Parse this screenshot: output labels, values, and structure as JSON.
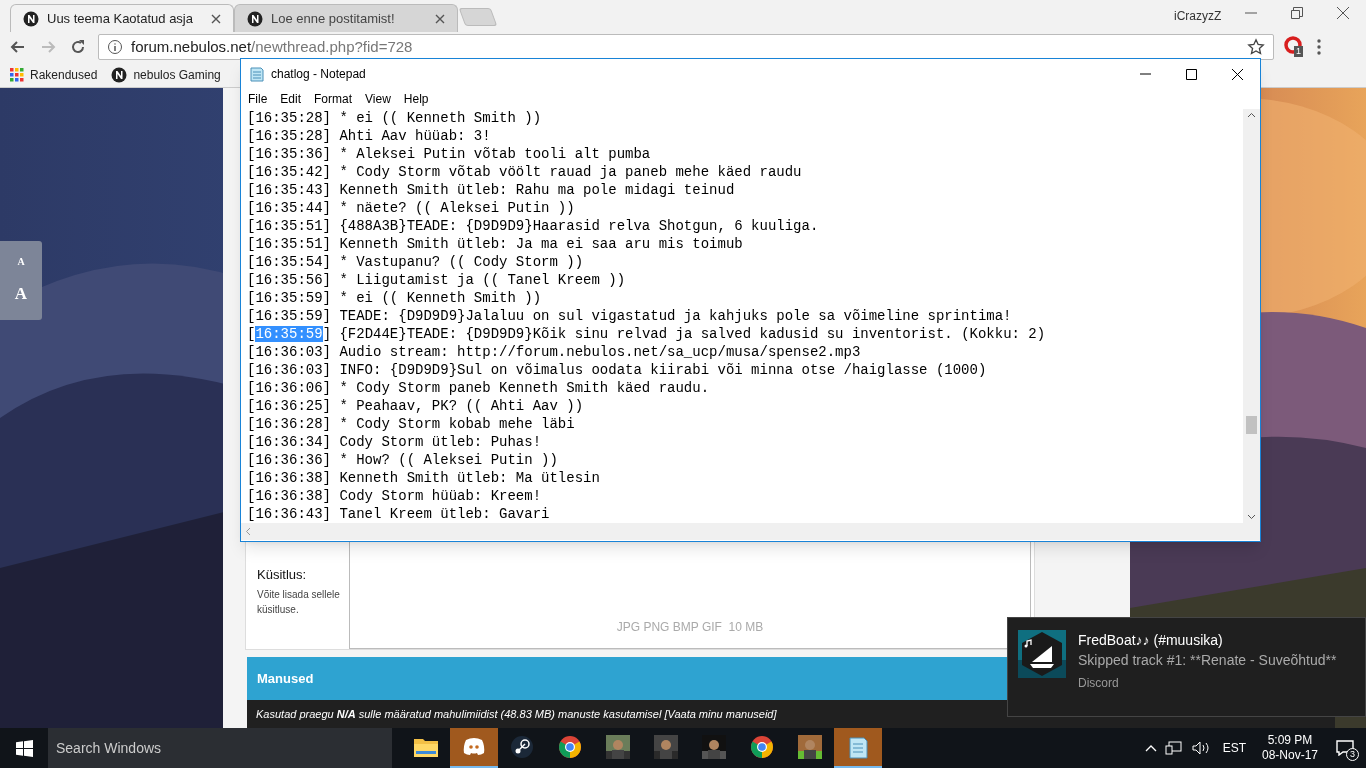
{
  "browser": {
    "tabs": [
      {
        "title": "Uus teema Kaotatud asja",
        "selected": true
      },
      {
        "title": "Loe enne postitamist!",
        "selected": false
      }
    ],
    "profile": "iCrazyzZ",
    "address": {
      "host": "forum.nebulos.net",
      "path": "/newthread.php?fid=728"
    },
    "extension_badge": "1",
    "bookmarks": [
      {
        "label": "Rakendused",
        "kind": "apps"
      },
      {
        "label": "nebulos Gaming",
        "kind": "site"
      }
    ]
  },
  "page": {
    "font_sizes": [
      "A",
      "A"
    ],
    "poll": {
      "title": "Küsitlus:",
      "text": "Võite lisada sellele küsitluse."
    },
    "upload_hint": "JPG PNG BMP GIF  10 MB",
    "attachments": {
      "title": "Manused",
      "text": "Kasutad praegu **N/A** sulle määratud mahulimiidist (48.83 MB) manuste kasutamisel [Vaata minu manuseid]"
    }
  },
  "notepad": {
    "title": "chatlog - Notepad",
    "menu": [
      "File",
      "Edit",
      "Format",
      "View",
      "Help"
    ],
    "lines": [
      {
        "text": "[16:35:28] * ei (( Kenneth Smith ))"
      },
      {
        "text": "[16:35:28] Ahti Aav hüüab: 3!"
      },
      {
        "text": "[16:35:36] * Aleksei Putin võtab tooli alt pumba"
      },
      {
        "text": "[16:35:42] * Cody Storm võtab vöölt rauad ja paneb mehe käed raudu"
      },
      {
        "text": "[16:35:43] Kenneth Smith ütleb: Rahu ma pole midagi teinud"
      },
      {
        "text": "[16:35:44] * näete? (( Aleksei Putin ))"
      },
      {
        "text": "[16:35:51] {488A3B}TEADE: {D9D9D9}Haarasid relva Shotgun, 6 kuuliga."
      },
      {
        "text": "[16:35:51] Kenneth Smith ütleb: Ja ma ei saa aru mis toimub"
      },
      {
        "text": "[16:35:54] * Vastupanu? (( Cody Storm ))"
      },
      {
        "text": "[16:35:56] * Liigutamist ja (( Tanel Kreem ))"
      },
      {
        "text": "[16:35:59] * ei (( Kenneth Smith ))"
      },
      {
        "text": "[16:35:59] TEADE: {D9D9D9}Jalaluu on sul vigastatud ja kahjuks pole sa võimeline sprintima!"
      },
      {
        "text": "[",
        "selection": "16:35:59",
        "rest": "] {F2D44E}TEADE: {D9D9D9}Kõik sinu relvad ja salved kadusid su inventorist. (Kokku: 2)"
      },
      {
        "text": "[16:36:03] Audio stream: http://forum.nebulos.net/sa_ucp/musa/spense2.mp3"
      },
      {
        "text": "[16:36:03] INFO: {D9D9D9}Sul on võimalus oodata kiirabi või minna otse /haiglasse (1000)"
      },
      {
        "text": "[16:36:06] * Cody Storm paneb Kenneth Smith käed raudu."
      },
      {
        "text": "[16:36:25] * Peahaav, PK? (( Ahti Aav ))"
      },
      {
        "text": "[16:36:28] * Cody Storm kobab mehe läbi"
      },
      {
        "text": "[16:36:34] Cody Storm ütleb: Puhas!"
      },
      {
        "text": "[16:36:36] * How? (( Aleksei Putin ))"
      },
      {
        "text": "[16:36:38] Kenneth Smith ütleb: Ma ütlesin"
      },
      {
        "text": "[16:36:38] Cody Storm hüüab: Kreem!"
      },
      {
        "text": "[16:36:43] Tanel Kreem ütleb: Gavari"
      }
    ]
  },
  "notification": {
    "title": "FredBoat♪♪ (#muusika)",
    "text": "Skipped track #1: **Renate - Suveõhtud**",
    "source": "Discord"
  },
  "taskbar": {
    "search_placeholder": "Search Windows",
    "apps": [
      {
        "kind": "folder",
        "active": false
      },
      {
        "kind": "discord",
        "active": true
      },
      {
        "kind": "steam",
        "active": false
      },
      {
        "kind": "chrome",
        "active": false
      },
      {
        "kind": "picture",
        "active": false
      },
      {
        "kind": "picture",
        "active": false
      },
      {
        "kind": "picture",
        "active": false
      },
      {
        "kind": "chrome",
        "active": false
      },
      {
        "kind": "picture",
        "active": false
      },
      {
        "kind": "notepad",
        "active": true
      }
    ],
    "language": "EST",
    "time": "5:09 PM",
    "date": "08-Nov-17",
    "notification_count": "3"
  }
}
